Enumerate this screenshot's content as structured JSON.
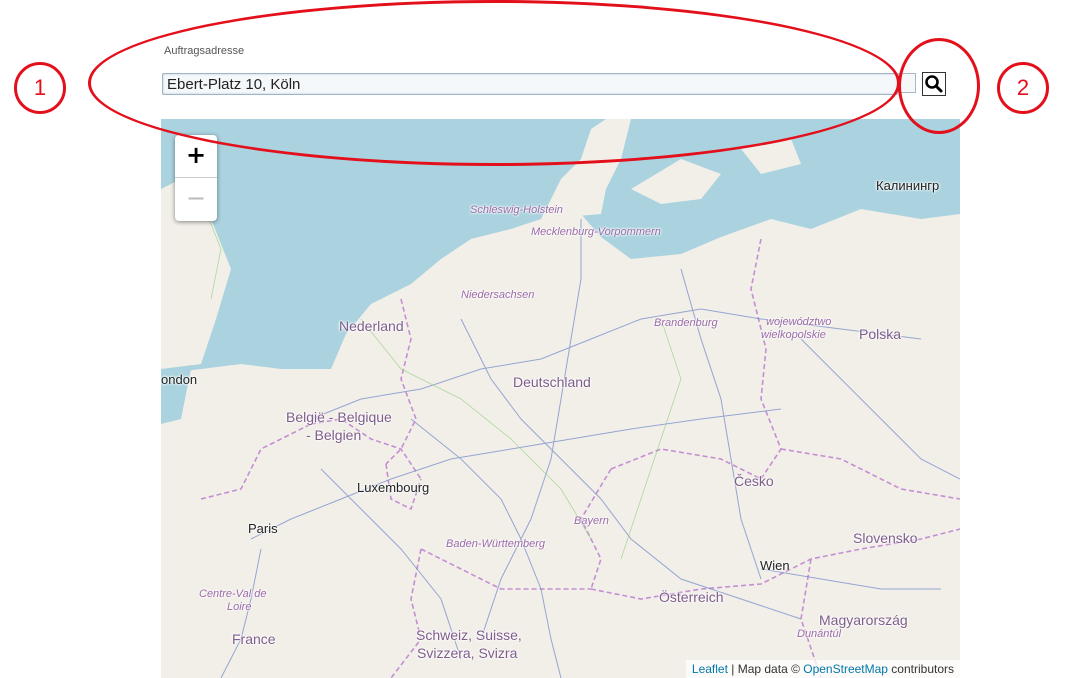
{
  "form": {
    "address_label": "Auftragsadresse",
    "address_value": "Ebert-Platz 10, Köln"
  },
  "callouts": [
    {
      "number": "1",
      "color": "#e3101b"
    },
    {
      "number": "2",
      "color": "#e3101b"
    }
  ],
  "map": {
    "zoom_in": "+",
    "zoom_out": "−",
    "labels": [
      {
        "text": "Калинингр",
        "kind": "city"
      },
      {
        "text": "Schleswig-Holstein",
        "kind": "region"
      },
      {
        "text": "Mecklenburg-Vorpommern",
        "kind": "region"
      },
      {
        "text": "Niedersachsen",
        "kind": "region"
      },
      {
        "text": "Nederland",
        "kind": "country"
      },
      {
        "text": "Brandenburg",
        "kind": "region"
      },
      {
        "text": "województwo",
        "kind": "region"
      },
      {
        "text": "wielkopolskie",
        "kind": "region"
      },
      {
        "text": "Polska",
        "kind": "country"
      },
      {
        "text": "ondon",
        "kind": "city"
      },
      {
        "text": "Deutschland",
        "kind": "country"
      },
      {
        "text": "België - Belgique",
        "kind": "country"
      },
      {
        "text": "- Belgien",
        "kind": "country"
      },
      {
        "text": "Luxembourg",
        "kind": "city"
      },
      {
        "text": "Česko",
        "kind": "country"
      },
      {
        "text": "Paris",
        "kind": "city"
      },
      {
        "text": "Bayern",
        "kind": "region"
      },
      {
        "text": "Baden-Württemberg",
        "kind": "region"
      },
      {
        "text": "Slovensko",
        "kind": "country"
      },
      {
        "text": "Wien",
        "kind": "city"
      },
      {
        "text": "Centre-Val de",
        "kind": "region"
      },
      {
        "text": "Loire",
        "kind": "region"
      },
      {
        "text": "Österreich",
        "kind": "country"
      },
      {
        "text": "Magyarország",
        "kind": "country"
      },
      {
        "text": "France",
        "kind": "country"
      },
      {
        "text": "Schweiz, Suisse,",
        "kind": "country"
      },
      {
        "text": "Dunántúl",
        "kind": "region"
      },
      {
        "text": "Svizzera, Svizra",
        "kind": "country"
      }
    ],
    "attribution": {
      "leaflet": "Leaflet",
      "separator": " | Map data © ",
      "osm": "OpenStreetMap",
      "suffix": " contributors"
    },
    "colors": {
      "sea": "#aad3df",
      "land": "#f2efe9",
      "border": "#c48fd2",
      "road": "#6f86c8"
    }
  },
  "icons": {
    "search": "search-icon"
  }
}
